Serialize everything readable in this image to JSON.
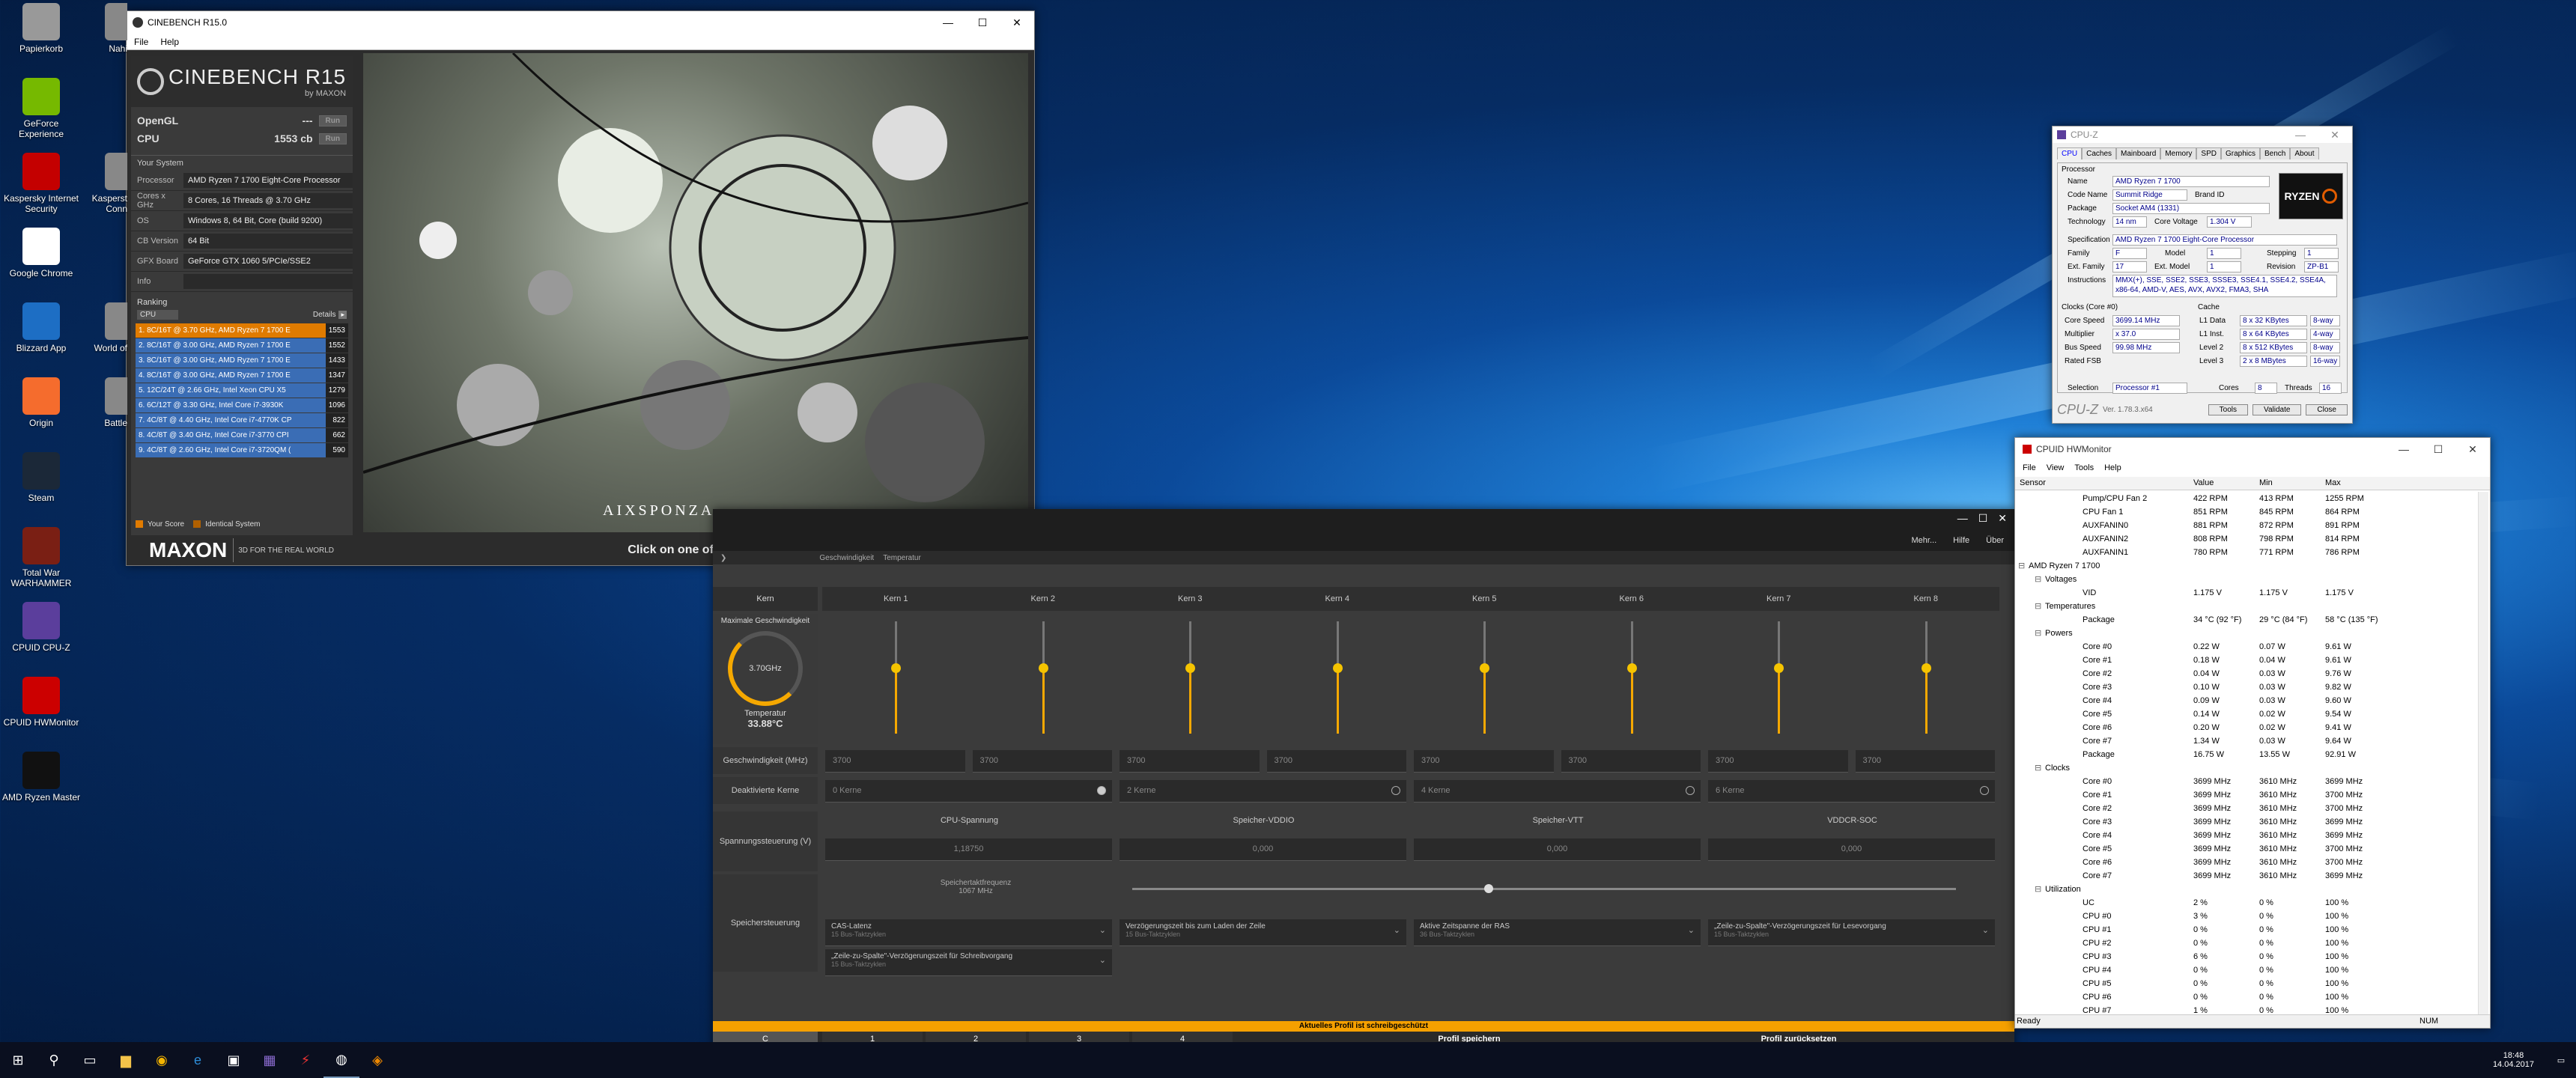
{
  "desktop": {
    "icons": [
      "Papierkorb",
      "GeForce Experience",
      "Kaspersky Internet Security",
      "Google Chrome",
      "Blizzard App",
      "Origin",
      "Steam",
      "Total War WARHAMMER",
      "CPUID CPU-Z",
      "CPUID HWMonitor",
      "AMD Ryzen Master"
    ],
    "icons_col2": [
      "Nahi",
      "Kasperst Conn",
      "World of",
      "Battle"
    ]
  },
  "cinebench": {
    "title": "CINEBENCH R15.0",
    "menu": [
      "File",
      "Help"
    ],
    "logo": "CINEBENCH R15",
    "logo_sub": "by MAXON",
    "opengl_label": "OpenGL",
    "opengl_value": "---",
    "cpu_label": "CPU",
    "cpu_value": "1553 cb",
    "run": "Run",
    "your_system": "Your System",
    "system": [
      {
        "k": "Processor",
        "v": "AMD Ryzen 7 1700 Eight-Core Processor"
      },
      {
        "k": "Cores x GHz",
        "v": "8 Cores, 16 Threads @ 3.70 GHz"
      },
      {
        "k": "OS",
        "v": "Windows 8, 64 Bit, Core (build 9200)"
      },
      {
        "k": "CB Version",
        "v": "64 Bit"
      },
      {
        "k": "GFX Board",
        "v": "GeForce GTX 1060 5/PCIe/SSE2"
      },
      {
        "k": "Info",
        "v": ""
      }
    ],
    "ranking": "Ranking",
    "rank_select": "CPU",
    "details": "Details",
    "ranks": [
      {
        "l": "1. 8C/16T @ 3.70 GHz, AMD Ryzen 7 1700 E",
        "s": "1553",
        "c": "#e07b00"
      },
      {
        "l": "2. 8C/16T @ 3.00 GHz, AMD Ryzen 7 1700 E",
        "s": "1552",
        "c": "#3a6db5"
      },
      {
        "l": "3. 8C/16T @ 3.00 GHz, AMD Ryzen 7 1700 E",
        "s": "1433",
        "c": "#3a6db5"
      },
      {
        "l": "4. 8C/16T @ 3.00 GHz, AMD Ryzen 7 1700 E",
        "s": "1347",
        "c": "#3a6db5"
      },
      {
        "l": "5. 12C/24T @ 2.66 GHz, Intel Xeon CPU X5",
        "s": "1279",
        "c": "#3a6db5"
      },
      {
        "l": "6. 6C/12T @ 3.30 GHz, Intel Core i7-3930K",
        "s": "1096",
        "c": "#3a6db5"
      },
      {
        "l": "7. 4C/8T @ 4.40 GHz, Intel Core i7-4770K CP",
        "s": "822",
        "c": "#3a6db5"
      },
      {
        "l": "8. 4C/8T @ 3.40 GHz, Intel Core i7-3770 CPI",
        "s": "662",
        "c": "#3a6db5"
      },
      {
        "l": "9. 4C/8T @ 2.60 GHz, Intel Core i7-3720QM (",
        "s": "590",
        "c": "#3a6db5"
      }
    ],
    "legend_your": "Your Score",
    "legend_identical": "Identical System",
    "brand": "MAXON",
    "tagline": "3D FOR THE REAL WORLD",
    "status": "Click on one of the 'Run' buttons to start a test.",
    "render_credit": "AIXSPONZA"
  },
  "ryzen": {
    "top_links": [
      "Mehr...",
      "Hilfe",
      "Über"
    ],
    "tabs": [
      "Geschwindigkeit",
      "Temperatur"
    ],
    "kern_header": "Kern",
    "cores": [
      "Kern 1",
      "Kern 2",
      "Kern 3",
      "Kern 4",
      "Kern 5",
      "Kern 6",
      "Kern 7",
      "Kern 8"
    ],
    "max_speed": "Maximale Geschwindigkeit",
    "gauge_value": "3.70GHz",
    "temp_label": "Temperatur",
    "temp_value": "33.88°C",
    "speed_label": "Geschwindigkeit (MHz)",
    "speeds": [
      "3700",
      "3700",
      "3700",
      "3700",
      "3700",
      "3700",
      "3700",
      "3700"
    ],
    "disabled_label": "Deaktivierte Kerne",
    "disabled": [
      "0 Kerne",
      "2 Kerne",
      "4 Kerne",
      "6 Kerne"
    ],
    "voltage_label": "Spannungssteuerung (V)",
    "voltage_cols": [
      "CPU-Spannung",
      "Speicher-VDDIO",
      "Speicher-VTT",
      "VDDCR-SOC"
    ],
    "voltage_vals": [
      "1,18750",
      "0,000",
      "0,000",
      "0,000"
    ],
    "mem_label": "Speichersteuerung",
    "mem_clock_label": "Speichertaktfrequenz",
    "mem_clock": "1067 MHz",
    "mem_fields": [
      {
        "n": "CAS-Latenz",
        "v": "15 Bus-Taktzyklen"
      },
      {
        "n": "Verzögerungszeit bis zum Laden der Zeile",
        "v": "15 Bus-Taktzyklen"
      },
      {
        "n": "Aktive Zeitspanne der RAS",
        "v": "36 Bus-Taktzyklen"
      },
      {
        "n": "„Zeile-zu-Spalte\"-Verzögerungszeit für Lesevorgang",
        "v": "15 Bus-Taktzyklen"
      },
      {
        "n": "„Zeile-zu-Spalte\"-Verzögerungszeit für Schreibvorgang",
        "v": "15 Bus-Taktzyklen"
      }
    ],
    "warning": "Aktuelles Profil ist schreibgeschützt",
    "profiles": [
      "C",
      "1",
      "2",
      "3",
      "4"
    ],
    "save": "Profil speichern",
    "reset": "Profil zurücksetzen"
  },
  "cpuz": {
    "title": "CPU-Z",
    "tabs": [
      "CPU",
      "Caches",
      "Mainboard",
      "Memory",
      "SPD",
      "Graphics",
      "Bench",
      "About"
    ],
    "processor": "Processor",
    "name_l": "Name",
    "name": "AMD Ryzen 7 1700",
    "codename_l": "Code Name",
    "codename": "Summit Ridge",
    "brand_l": "Brand ID",
    "package_l": "Package",
    "package": "Socket AM4 (1331)",
    "tech_l": "Technology",
    "tech": "14 nm",
    "cv_l": "Core Voltage",
    "cv": "1.304 V",
    "spec_l": "Specification",
    "spec": "AMD Ryzen 7 1700 Eight-Core Processor",
    "family_l": "Family",
    "family": "F",
    "model_l": "Model",
    "model": "1",
    "stepping_l": "Stepping",
    "stepping": "1",
    "extfam_l": "Ext. Family",
    "extfam": "17",
    "extmod_l": "Ext. Model",
    "extmod": "1",
    "rev_l": "Revision",
    "rev": "ZP-B1",
    "instr_l": "Instructions",
    "instr": "MMX(+), SSE, SSE2, SSE3, SSSE3, SSE4.1, SSE4.2, SSE4A, x86-64, AMD-V, AES, AVX, AVX2, FMA3, SHA",
    "clocks": "Clocks (Core #0)",
    "cs_l": "Core Speed",
    "cs": "3699.14 MHz",
    "mul_l": "Multiplier",
    "mul": "x 37.0",
    "bus_l": "Bus Speed",
    "bus": "99.98 MHz",
    "fsb_l": "Rated FSB",
    "cache": "Cache",
    "l1d_l": "L1 Data",
    "l1d": "8 x 32 KBytes",
    "l1d_w": "8-way",
    "l1i_l": "L1 Inst.",
    "l1i": "8 x 64 KBytes",
    "l1i_w": "4-way",
    "l2_l": "Level 2",
    "l2": "8 x 512 KBytes",
    "l2_w": "8-way",
    "l3_l": "Level 3",
    "l3": "2 x 8 MBytes",
    "l3_w": "16-way",
    "sel_l": "Selection",
    "sel": "Processor #1",
    "cores_l": "Cores",
    "cores": "8",
    "threads_l": "Threads",
    "threads": "16",
    "logo": "CPU-Z",
    "ver": "Ver. 1.78.3.x64",
    "tools": "Tools",
    "validate": "Validate",
    "close": "Close",
    "ryzen_logo": "RYZEN"
  },
  "hwmon": {
    "title": "CPUID HWMonitor",
    "menu": [
      "File",
      "View",
      "Tools",
      "Help"
    ],
    "cols": [
      "Sensor",
      "Value",
      "Min",
      "Max"
    ],
    "rows": [
      {
        "i": 3,
        "n": "Pump/CPU Fan 2",
        "v": "422 RPM",
        "mi": "413 RPM",
        "ma": "1255 RPM"
      },
      {
        "i": 3,
        "n": "CPU Fan 1",
        "v": "851 RPM",
        "mi": "845 RPM",
        "ma": "864 RPM"
      },
      {
        "i": 3,
        "n": "AUXFANIN0",
        "v": "881 RPM",
        "mi": "872 RPM",
        "ma": "891 RPM"
      },
      {
        "i": 3,
        "n": "AUXFANIN2",
        "v": "808 RPM",
        "mi": "798 RPM",
        "ma": "814 RPM"
      },
      {
        "i": 3,
        "n": "AUXFANIN1",
        "v": "780 RPM",
        "mi": "771 RPM",
        "ma": "786 RPM"
      },
      {
        "i": 1,
        "n": "AMD Ryzen 7 1700",
        "v": "",
        "mi": "",
        "ma": ""
      },
      {
        "i": 2,
        "n": "Voltages",
        "v": "",
        "mi": "",
        "ma": ""
      },
      {
        "i": 3,
        "n": "VID",
        "v": "1.175 V",
        "mi": "1.175 V",
        "ma": "1.175 V"
      },
      {
        "i": 2,
        "n": "Temperatures",
        "v": "",
        "mi": "",
        "ma": ""
      },
      {
        "i": 3,
        "n": "Package",
        "v": "34 °C (92 °F)",
        "mi": "29 °C (84 °F)",
        "ma": "58 °C (135 °F)"
      },
      {
        "i": 2,
        "n": "Powers",
        "v": "",
        "mi": "",
        "ma": ""
      },
      {
        "i": 3,
        "n": "Core #0",
        "v": "0.22 W",
        "mi": "0.07 W",
        "ma": "9.61 W"
      },
      {
        "i": 3,
        "n": "Core #1",
        "v": "0.18 W",
        "mi": "0.04 W",
        "ma": "9.61 W"
      },
      {
        "i": 3,
        "n": "Core #2",
        "v": "0.04 W",
        "mi": "0.03 W",
        "ma": "9.76 W"
      },
      {
        "i": 3,
        "n": "Core #3",
        "v": "0.10 W",
        "mi": "0.03 W",
        "ma": "9.82 W"
      },
      {
        "i": 3,
        "n": "Core #4",
        "v": "0.09 W",
        "mi": "0.03 W",
        "ma": "9.60 W"
      },
      {
        "i": 3,
        "n": "Core #5",
        "v": "0.14 W",
        "mi": "0.02 W",
        "ma": "9.54 W"
      },
      {
        "i": 3,
        "n": "Core #6",
        "v": "0.20 W",
        "mi": "0.02 W",
        "ma": "9.41 W"
      },
      {
        "i": 3,
        "n": "Core #7",
        "v": "1.34 W",
        "mi": "0.03 W",
        "ma": "9.64 W"
      },
      {
        "i": 3,
        "n": "Package",
        "v": "16.75 W",
        "mi": "13.55 W",
        "ma": "92.91 W"
      },
      {
        "i": 2,
        "n": "Clocks",
        "v": "",
        "mi": "",
        "ma": ""
      },
      {
        "i": 3,
        "n": "Core #0",
        "v": "3699 MHz",
        "mi": "3610 MHz",
        "ma": "3699 MHz"
      },
      {
        "i": 3,
        "n": "Core #1",
        "v": "3699 MHz",
        "mi": "3610 MHz",
        "ma": "3700 MHz"
      },
      {
        "i": 3,
        "n": "Core #2",
        "v": "3699 MHz",
        "mi": "3610 MHz",
        "ma": "3700 MHz"
      },
      {
        "i": 3,
        "n": "Core #3",
        "v": "3699 MHz",
        "mi": "3610 MHz",
        "ma": "3699 MHz"
      },
      {
        "i": 3,
        "n": "Core #4",
        "v": "3699 MHz",
        "mi": "3610 MHz",
        "ma": "3699 MHz"
      },
      {
        "i": 3,
        "n": "Core #5",
        "v": "3699 MHz",
        "mi": "3610 MHz",
        "ma": "3700 MHz"
      },
      {
        "i": 3,
        "n": "Core #6",
        "v": "3699 MHz",
        "mi": "3610 MHz",
        "ma": "3700 MHz"
      },
      {
        "i": 3,
        "n": "Core #7",
        "v": "3699 MHz",
        "mi": "3610 MHz",
        "ma": "3699 MHz"
      },
      {
        "i": 2,
        "n": "Utilization",
        "v": "",
        "mi": "",
        "ma": ""
      },
      {
        "i": 3,
        "n": "UC",
        "v": "2 %",
        "mi": "0 %",
        "ma": "100 %"
      },
      {
        "i": 3,
        "n": "CPU #0",
        "v": "3 %",
        "mi": "0 %",
        "ma": "100 %"
      },
      {
        "i": 3,
        "n": "CPU #1",
        "v": "0 %",
        "mi": "0 %",
        "ma": "100 %"
      },
      {
        "i": 3,
        "n": "CPU #2",
        "v": "0 %",
        "mi": "0 %",
        "ma": "100 %"
      },
      {
        "i": 3,
        "n": "CPU #3",
        "v": "6 %",
        "mi": "0 %",
        "ma": "100 %"
      },
      {
        "i": 3,
        "n": "CPU #4",
        "v": "0 %",
        "mi": "0 %",
        "ma": "100 %"
      },
      {
        "i": 3,
        "n": "CPU #5",
        "v": "0 %",
        "mi": "0 %",
        "ma": "100 %"
      },
      {
        "i": 3,
        "n": "CPU #6",
        "v": "0 %",
        "mi": "0 %",
        "ma": "100 %"
      },
      {
        "i": 3,
        "n": "CPU #7",
        "v": "1 %",
        "mi": "0 %",
        "ma": "100 %"
      }
    ],
    "status": "Ready",
    "num": "NUM"
  },
  "taskbar": {
    "time": "18:48",
    "date": "14.04.2017"
  }
}
